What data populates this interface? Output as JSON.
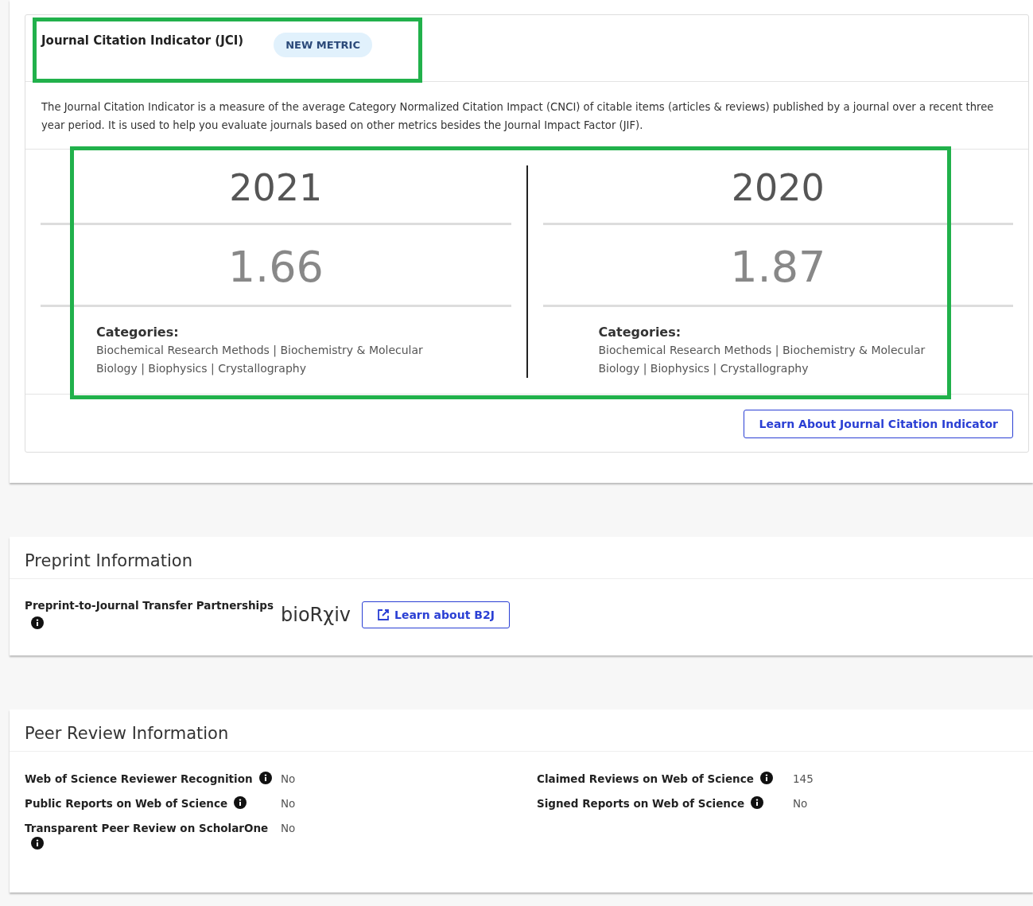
{
  "jci": {
    "title": "Journal Citation Indicator (JCI)",
    "badge": "NEW METRIC",
    "description": "The Journal Citation Indicator is a measure of the average Category Normalized Citation Impact (CNCI) of citable items (articles & reviews) published by a journal over a recent three year period. It is used to help you evaluate journals based on other metrics besides the Journal Impact Factor (JIF).",
    "years": [
      {
        "year": "2021",
        "value": "1.66",
        "categories_label": "Categories:",
        "categories": "Biochemical Research Methods | Biochemistry & Molecular Biology | Biophysics | Crystallography"
      },
      {
        "year": "2020",
        "value": "1.87",
        "categories_label": "Categories:",
        "categories": "Biochemical Research Methods | Biochemistry & Molecular Biology | Biophysics | Crystallography"
      }
    ],
    "button": "Learn About Journal Citation Indicator"
  },
  "preprint": {
    "title": "Preprint Information",
    "label": "Preprint-to-Journal Transfer Partnerships",
    "logo": "bioRχiv",
    "button": "Learn about B2J"
  },
  "peer_review": {
    "title": "Peer Review Information",
    "left": [
      {
        "label": "Web of Science Reviewer Recognition",
        "value": "No"
      },
      {
        "label": "Public Reports on Web of Science",
        "value": "No"
      },
      {
        "label": "Transparent Peer Review on ScholarOne",
        "value": "No"
      }
    ],
    "right": [
      {
        "label": "Claimed Reviews on Web of Science",
        "value": "145"
      },
      {
        "label": "Signed Reports on Web of Science",
        "value": "No"
      }
    ]
  }
}
